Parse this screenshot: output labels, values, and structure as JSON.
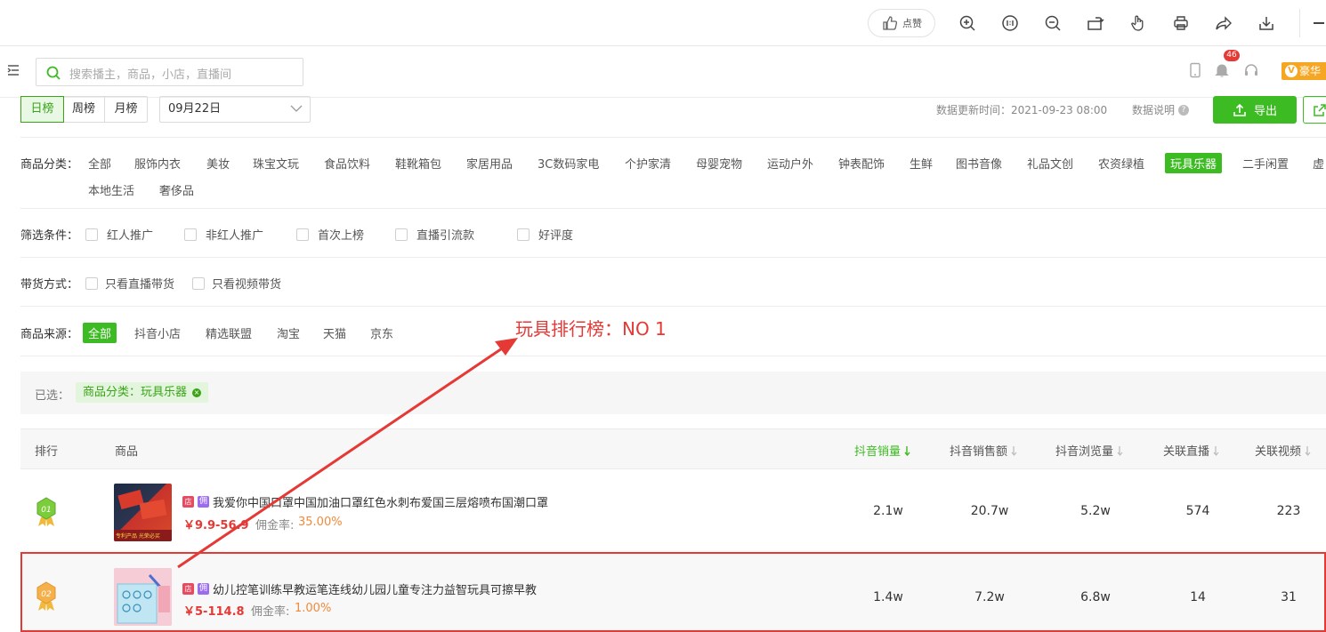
{
  "toolbar": {
    "like_label": "点赞",
    "icons": [
      "zoom-in-icon",
      "fit-icon",
      "zoom-out-icon",
      "rotate-icon",
      "hand-icon",
      "print-icon",
      "share-icon",
      "download-icon"
    ]
  },
  "header": {
    "search_placeholder": "搜索播主，商品，小店，直播间",
    "notification_count": "46",
    "vip_label": "豪华",
    "vip_badge": "V"
  },
  "period": {
    "tabs": [
      "日榜",
      "周榜",
      "月榜"
    ],
    "active_index": 0,
    "date_value": "09月22日",
    "update_time": "数据更新时间：2021-09-23 08:00",
    "data_note": "数据说明",
    "export_label": "导出"
  },
  "filters": {
    "category_label": "商品分类：",
    "categories": [
      "全部",
      "服饰内衣",
      "美妆",
      "珠宝文玩",
      "食品饮料",
      "鞋靴箱包",
      "家居用品",
      "3C数码家电",
      "个护家清",
      "母婴宠物",
      "运动户外",
      "钟表配饰",
      "生鲜",
      "图书音像",
      "礼品文创",
      "农资绿植",
      "玩具乐器",
      "二手闲置",
      "虚"
    ],
    "categories_row2": [
      "本地生活",
      "奢侈品"
    ],
    "active_category": "玩具乐器",
    "condition_label": "筛选条件：",
    "conditions": [
      "红人推广",
      "非红人推广",
      "首次上榜",
      "直播引流款",
      "好评度"
    ],
    "delivery_label": "带货方式：",
    "delivery": [
      "只看直播带货",
      "只看视频带货"
    ],
    "source_label": "商品来源：",
    "sources": [
      "全部",
      "抖音小店",
      "精选联盟",
      "淘宝",
      "天猫",
      "京东"
    ],
    "active_source": "全部"
  },
  "selected": {
    "label": "已选：",
    "tag": "商品分类：玩具乐器",
    "tag_close": "×"
  },
  "table": {
    "headers": {
      "rank": "排行",
      "product": "商品",
      "sales": "抖音销量",
      "revenue": "抖音销售额",
      "views": "抖音浏览量",
      "live": "关联直播",
      "video": "关联视频"
    },
    "rows": [
      {
        "rank": "01",
        "badge_shop": "店",
        "badge_yong": "佣",
        "name": "我爱你中国口罩中国加油口罩红色水刺布爱国三层熔喷布国潮口罩",
        "price": "￥9.9-56.9",
        "commission_label": "佣金率:",
        "commission": "35.00%",
        "sales": "2.1w",
        "revenue": "20.7w",
        "views": "5.2w",
        "live": "574",
        "video": "223",
        "thumb_caption": "专利产品  光荣必买"
      },
      {
        "rank": "02",
        "badge_shop": "店",
        "badge_yong": "佣",
        "name": "幼儿控笔训练早教运笔连线幼儿园儿童专注力益智玩具可擦早教",
        "price": "￥5-114.8",
        "commission_label": "佣金率:",
        "commission": "1.00%",
        "sales": "1.4w",
        "revenue": "7.2w",
        "views": "6.8w",
        "live": "14",
        "video": "31"
      }
    ]
  },
  "annotation": {
    "text": "玩具排行榜：NO  1"
  },
  "colors": {
    "brand_green": "#3dbb22",
    "price_red": "#e53935",
    "commission_orange": "#f08a3c",
    "annotation_red": "#e53935"
  }
}
